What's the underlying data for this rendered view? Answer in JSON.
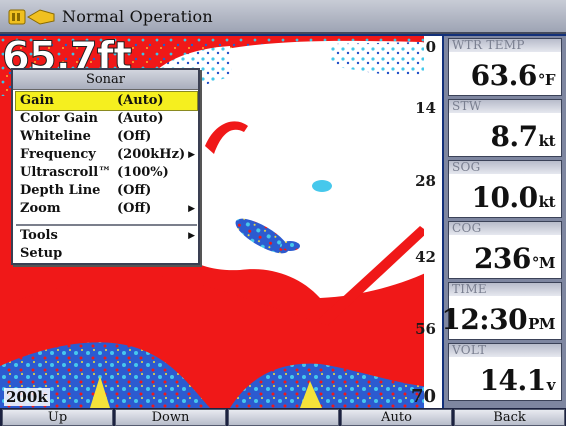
{
  "status_bar": {
    "title": "Normal Operation",
    "icons": [
      "battery-icon",
      "boat-icon"
    ]
  },
  "sonar": {
    "depth_readout": "65.7ft",
    "depth_scale": [
      "0",
      "14",
      "28",
      "42",
      "56",
      "70"
    ],
    "frequency_label": "200k"
  },
  "menu": {
    "title": "Sonar",
    "items": [
      {
        "label": "Gain",
        "value": "(Auto)",
        "submenu": false,
        "selected": true
      },
      {
        "label": "Color Gain",
        "value": "(Auto)",
        "submenu": false,
        "selected": false
      },
      {
        "label": "Whiteline",
        "value": "(Off)",
        "submenu": false,
        "selected": false
      },
      {
        "label": "Frequency",
        "value": "(200kHz)",
        "submenu": true,
        "selected": false
      },
      {
        "label": "Ultrascroll™",
        "value": "(100%)",
        "submenu": false,
        "selected": false
      },
      {
        "label": "Depth Line",
        "value": "(Off)",
        "submenu": false,
        "selected": false
      },
      {
        "label": "Zoom",
        "value": "(Off)",
        "submenu": true,
        "selected": false
      },
      {
        "label": "Tools",
        "value": "",
        "submenu": true,
        "selected": false
      },
      {
        "label": "Setup",
        "value": "",
        "submenu": false,
        "selected": false
      }
    ]
  },
  "data_panels": [
    {
      "label": "WTR TEMP",
      "value": "63.6",
      "unit": "°F"
    },
    {
      "label": "STW",
      "value": "8.7",
      "unit": "kt"
    },
    {
      "label": "SOG",
      "value": "10.0",
      "unit": "kt"
    },
    {
      "label": "COG",
      "value": "236",
      "unit": "°M"
    },
    {
      "label": "TIME",
      "value": "12:30",
      "unit": "PM"
    },
    {
      "label": "VOLT",
      "value": "14.1",
      "unit": "v"
    }
  ],
  "softkeys": [
    "Up",
    "Down",
    "",
    "Auto",
    "Back"
  ],
  "colors": {
    "sonar_red": "#f01818",
    "sonar_white": "#ffffff",
    "sonar_cyan": "#38c8e8",
    "sonar_blue": "#1840b8",
    "highlight": "#f5ef1f"
  }
}
